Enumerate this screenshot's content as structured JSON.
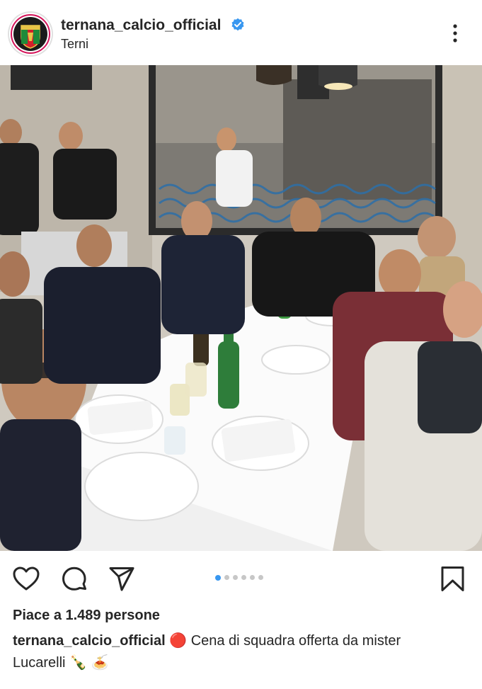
{
  "post": {
    "username": "ternana_calcio_official",
    "location": "Terni",
    "verified": true,
    "avatar_icon": "ternana-crest-icon",
    "more_icon": "three-dots-vertical-icon"
  },
  "photo": {
    "alt": ""
  },
  "actions": {
    "like_icon": "heart-icon",
    "comment_icon": "comment-bubble-icon",
    "share_icon": "paper-plane-icon",
    "save_icon": "bookmark-icon"
  },
  "carousel": {
    "total": 6,
    "active_index": 0
  },
  "likes_text": "Piace a 1.489 persone",
  "caption": {
    "user": "ternana_calcio_official",
    "text_part1": "Cena di squadra offerta da mister",
    "text_part2": "Lucarelli",
    "emoji_1": "🔴",
    "emoji_2": "🍾",
    "emoji_3": "🍝"
  },
  "colors": {
    "verified_blue": "#3897f0",
    "carousel_active": "#3897f0",
    "text": "#262626"
  }
}
